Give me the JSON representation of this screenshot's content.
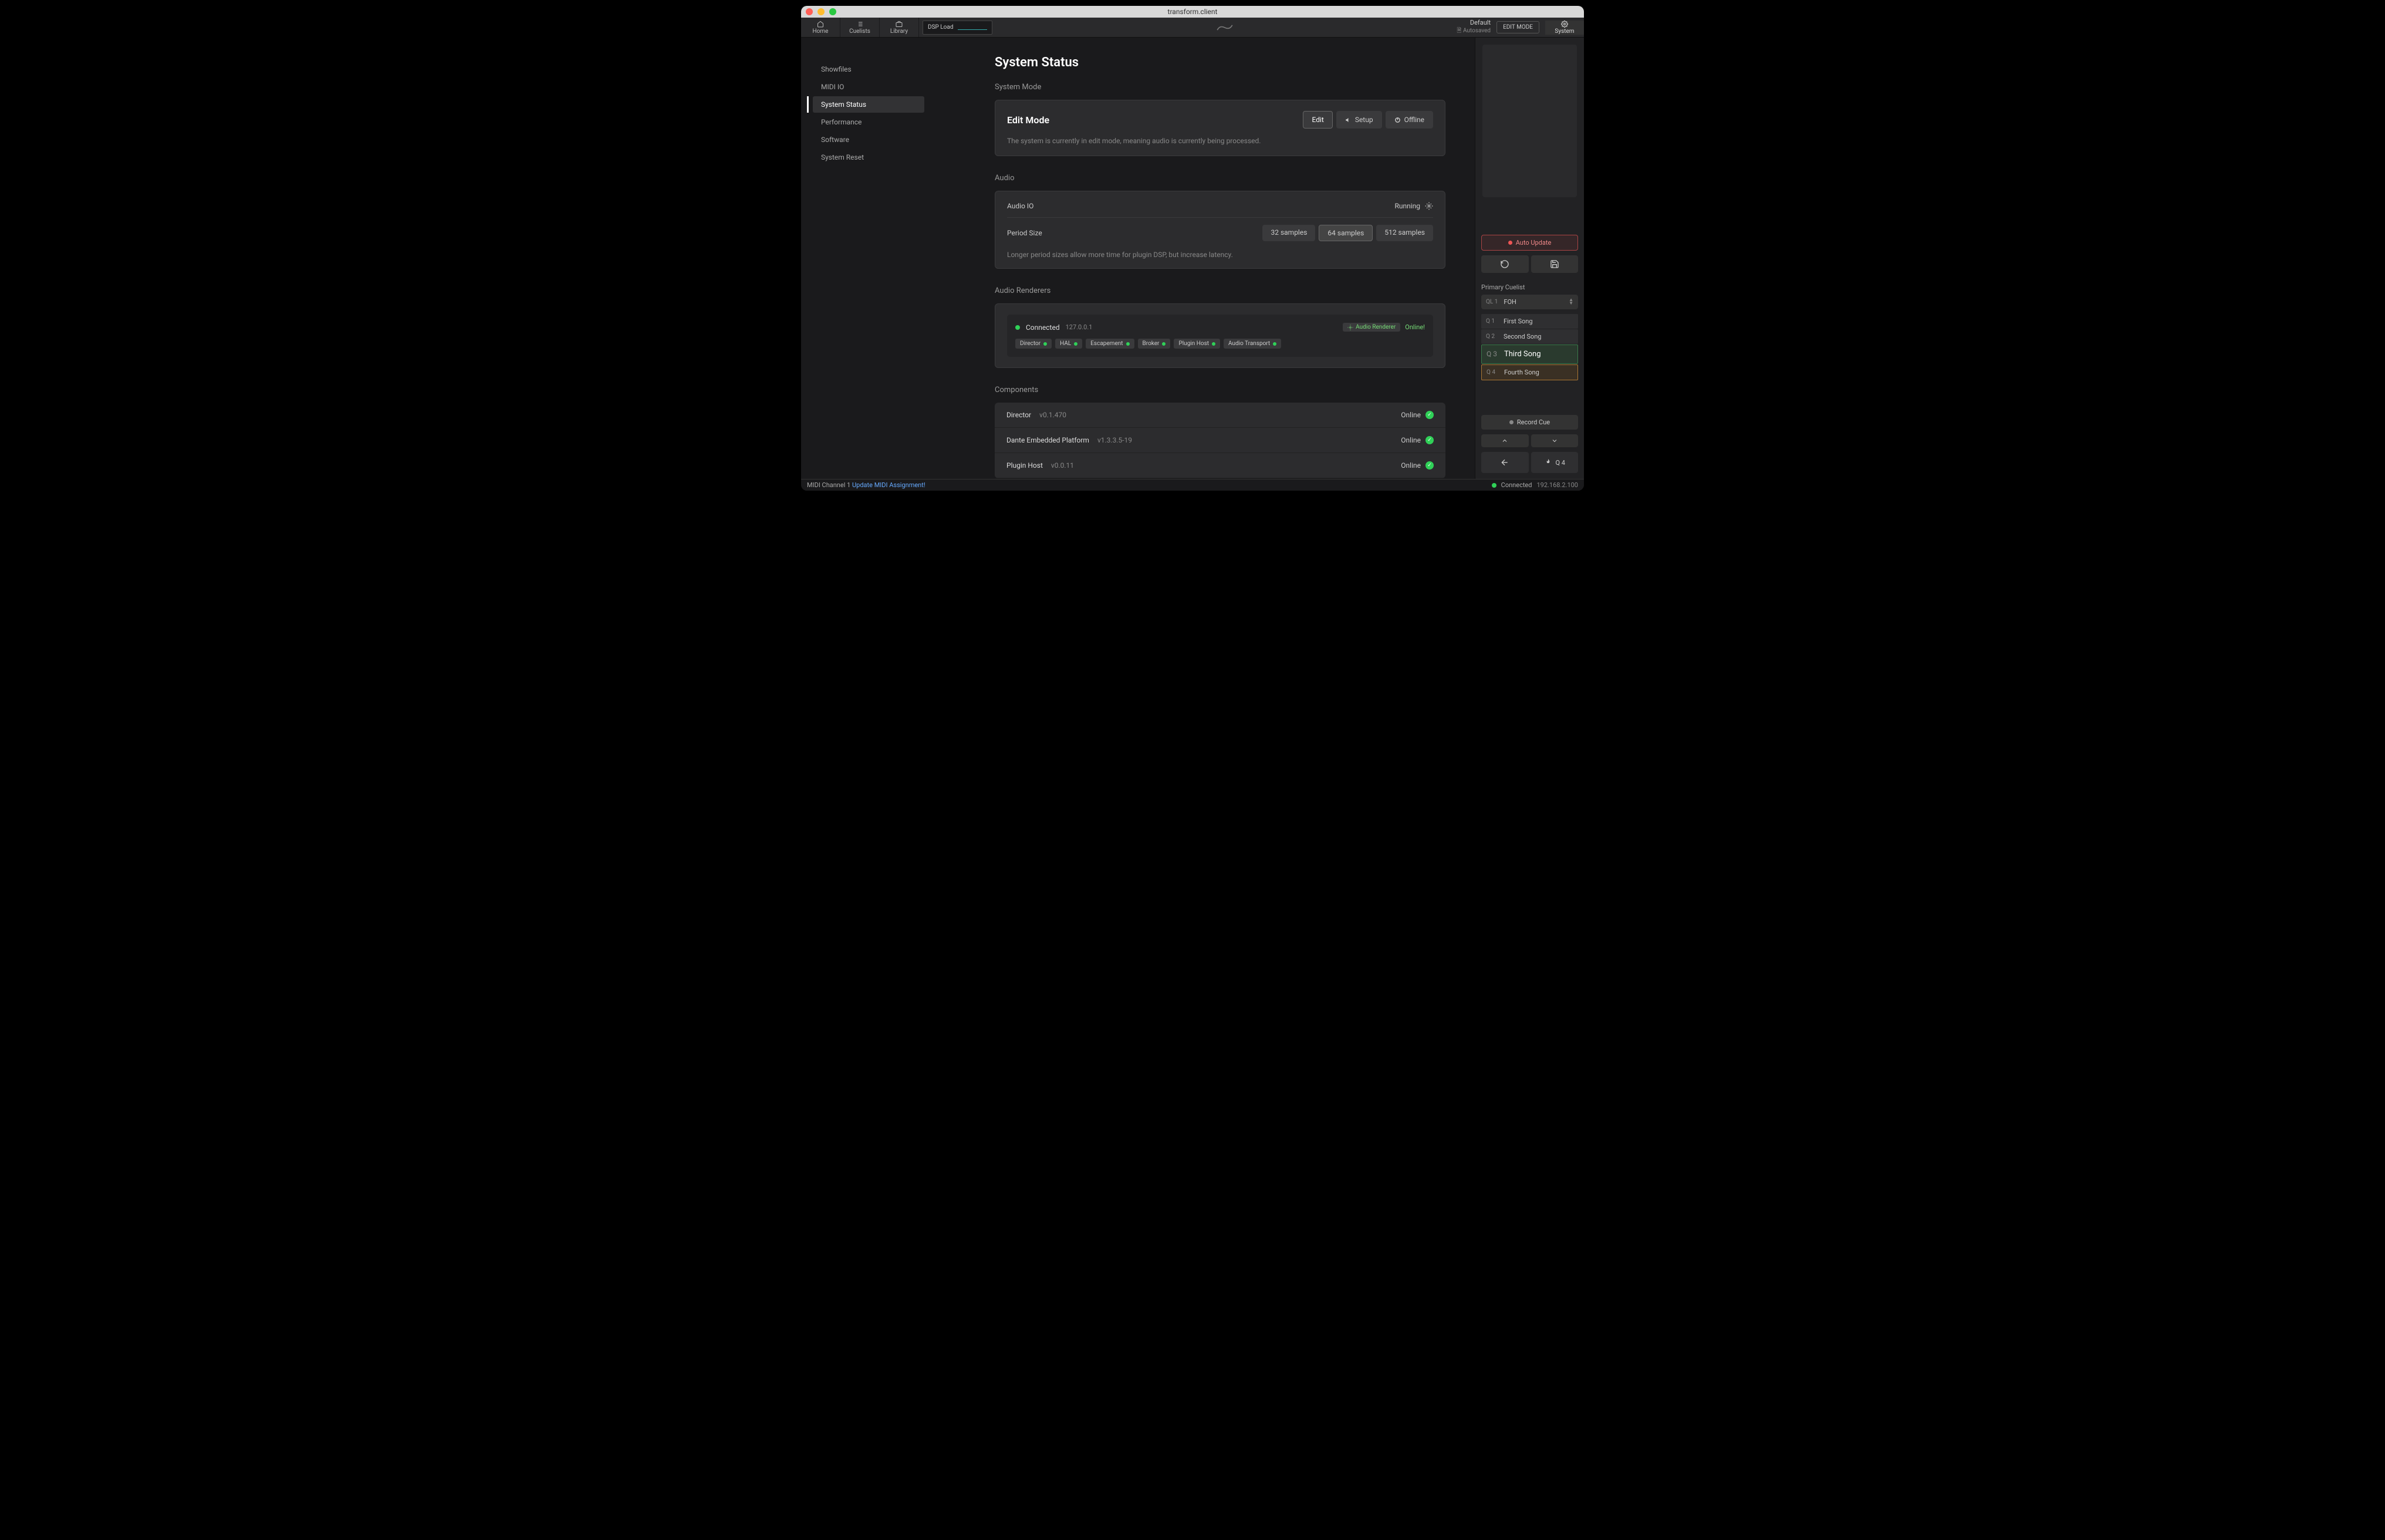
{
  "window_title": "transform.client",
  "topbar": {
    "items": [
      {
        "label": "Home"
      },
      {
        "label": "Cuelists"
      },
      {
        "label": "Library"
      }
    ],
    "dsp_label": "DSP Load",
    "show_name": "Default",
    "autosaved": "Autosaved",
    "editmode_pill": "EDIT MODE",
    "system_tab": "System"
  },
  "sidebar": {
    "items": [
      {
        "label": "Showfiles"
      },
      {
        "label": "MIDI IO"
      },
      {
        "label": "System Status"
      },
      {
        "label": "Performance"
      },
      {
        "label": "Software"
      },
      {
        "label": "System Reset"
      }
    ]
  },
  "page": {
    "title": "System Status",
    "mode_section": "System Mode",
    "mode_title": "Edit Mode",
    "mode_buttons": {
      "edit": "Edit",
      "setup": "Setup",
      "offline": "Offline"
    },
    "mode_desc": "The system is currently in edit mode, meaning audio is currently being processed.",
    "audio_section": "Audio",
    "audio_io_label": "Audio IO",
    "audio_io_status": "Running",
    "period_label": "Period Size",
    "period_options": {
      "a": "32 samples",
      "b": "64 samples",
      "c": "512 samples"
    },
    "period_desc": "Longer period sizes allow more time for plugin DSP, but increase latency.",
    "renderers_section": "Audio Renderers",
    "renderer": {
      "status": "Connected",
      "ip": "127.0.0.1",
      "badge": "Audio Renderer",
      "online": "Online!",
      "chips": [
        {
          "label": "Director"
        },
        {
          "label": "HAL"
        },
        {
          "label": "Escapement"
        },
        {
          "label": "Broker"
        },
        {
          "label": "Plugin Host"
        },
        {
          "label": "Audio Transport"
        }
      ]
    },
    "components_section": "Components",
    "components": [
      {
        "name": "Director",
        "version": "v0.1.470",
        "status": "Online"
      },
      {
        "name": "Dante Embedded Platform",
        "version": "v1.3.3.5-19",
        "status": "Online"
      },
      {
        "name": "Plugin Host",
        "version": "v0.0.11",
        "status": "Online"
      }
    ]
  },
  "right": {
    "auto_update": "Auto Update",
    "primary_label": "Primary Cuelist",
    "ql_prefix": "QL 1",
    "selected_cuelist": "FOH",
    "cues": [
      {
        "q": "Q 1",
        "name": "First Song"
      },
      {
        "q": "Q 2",
        "name": "Second Song"
      },
      {
        "q": "Q 3",
        "name": "Third Song"
      },
      {
        "q": "Q 4",
        "name": "Fourth Song"
      }
    ],
    "record_cue": "Record Cue",
    "go_q": "Q 4"
  },
  "statusbar": {
    "midi_channel": "MIDI Channel 1",
    "midi_link": "Update MIDI Assignment!",
    "connected": "Connected",
    "ip": "192.168.2.100"
  }
}
